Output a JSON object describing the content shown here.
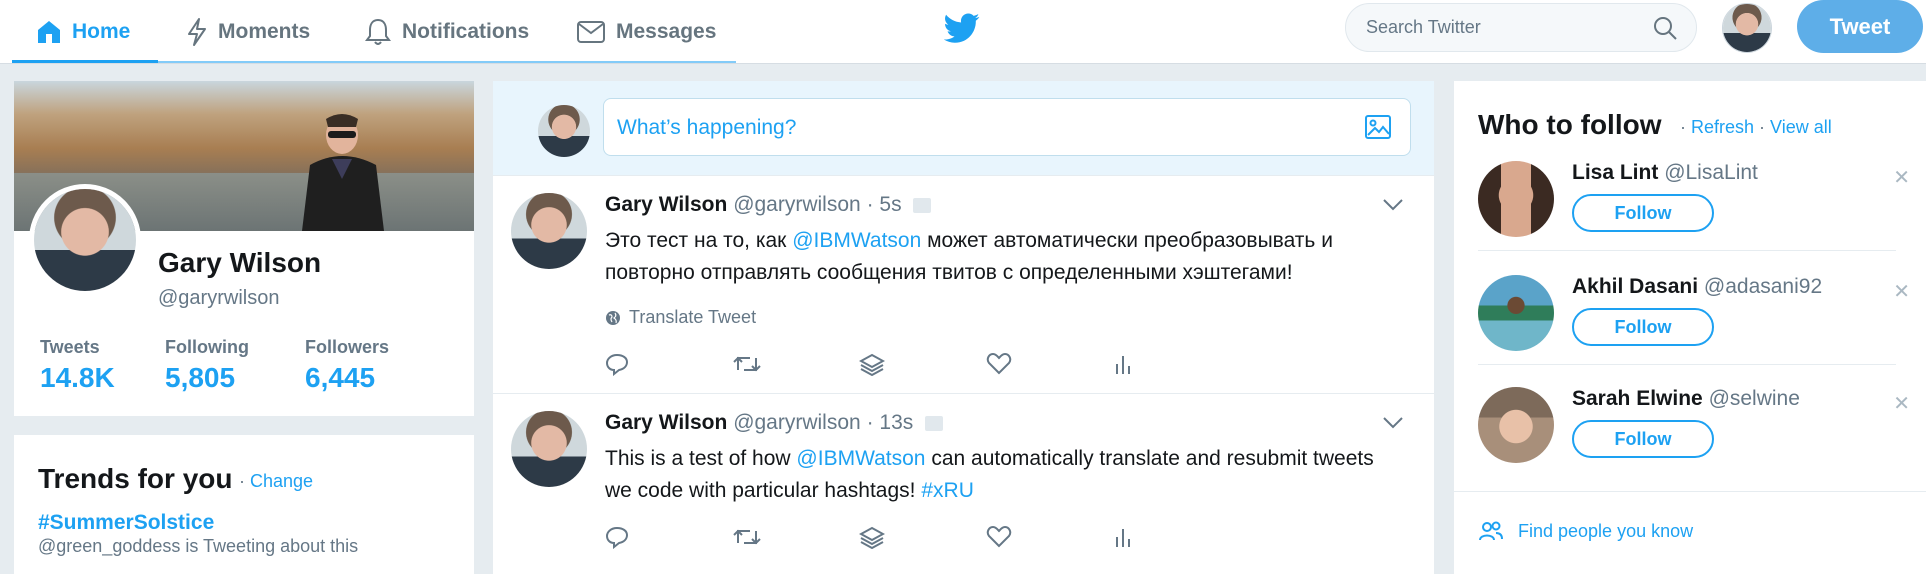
{
  "nav": {
    "home": "Home",
    "moments": "Moments",
    "notifications": "Notifications",
    "messages": "Messages",
    "search_placeholder": "Search Twitter",
    "tweet_button": "Tweet"
  },
  "profile": {
    "name": "Gary Wilson",
    "handle": "@garyrwilson",
    "stats": [
      {
        "label": "Tweets",
        "value": "14.8K"
      },
      {
        "label": "Following",
        "value": "5,805"
      },
      {
        "label": "Followers",
        "value": "6,445"
      }
    ]
  },
  "trends": {
    "title": "Trends for you",
    "change": "Change",
    "items": [
      {
        "tag": "#SummerSolstice",
        "meta": "@green_goddess is Tweeting about this"
      }
    ]
  },
  "composer": {
    "placeholder": "What’s happening?"
  },
  "tweets": [
    {
      "name": "Gary Wilson",
      "handle": "@garyrwilson",
      "time": "· 5s",
      "text_before": "Это тест на то, как ",
      "mention": "@IBMWatson",
      "text_after": " может автоматически преобразовывать и повторно отправлять сообщения твитов с определенными хэштегами!",
      "translate": "Translate Tweet"
    },
    {
      "name": "Gary Wilson",
      "handle": "@garyrwilson",
      "time": "· 13s",
      "text_before": "This is a test of how ",
      "mention": "@IBMWatson",
      "text_after": " can automatically translate and resubmit tweets we code with particular hashtags! ",
      "hashtag": "#xRU"
    }
  ],
  "who_to_follow": {
    "title": "Who to follow",
    "refresh": "Refresh",
    "view_all": "View all",
    "follow_label": "Follow",
    "users": [
      {
        "name": "Lisa Lint",
        "handle": "@LisaLint"
      },
      {
        "name": "Akhil Dasani",
        "handle": "@adasani92"
      },
      {
        "name": "Sarah Elwine",
        "handle": "@selwine"
      }
    ],
    "find_people": "Find people you know"
  },
  "colors": {
    "accent": "#1da1f2",
    "tweet_button": "#5eaee8",
    "background": "#e6ecf0",
    "muted_text": "#657786"
  }
}
